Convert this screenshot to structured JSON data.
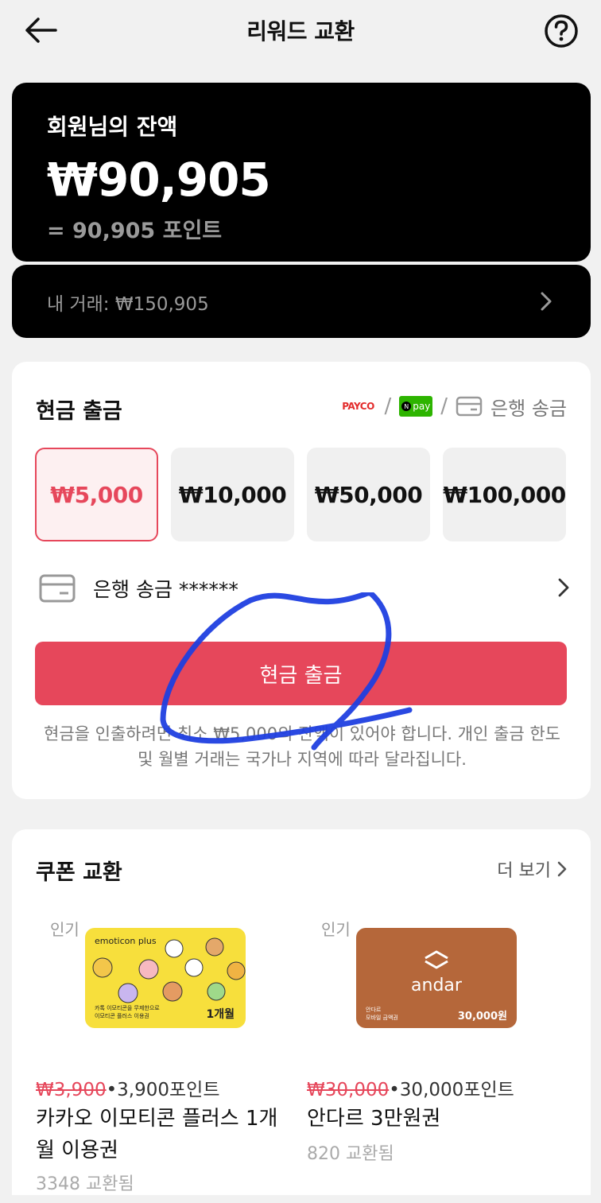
{
  "header": {
    "title": "리워드 교환"
  },
  "balance": {
    "label": "회원님의 잔액",
    "amount": "₩90,905",
    "points": "= 90,905 포인트",
    "transactions": "내 거래: ₩150,905"
  },
  "cash_withdrawal": {
    "title": "현금 출금",
    "methods": {
      "payco": "PAYCO",
      "npay": "pay",
      "bank": "은행 송금",
      "separator": "/"
    },
    "amounts": [
      {
        "label": "₩5,000",
        "selected": true
      },
      {
        "label": "₩10,000",
        "selected": false
      },
      {
        "label": "₩50,000",
        "selected": false
      },
      {
        "label": "₩100,000",
        "selected": false
      }
    ],
    "bank_account": "은행 송금 ******",
    "button": "현금 출금",
    "notice": "현금을 인출하려면 최소 ₩5,000의 잔액이 있어야 합니다. 개인 출금 한도 및 월별 거래는 국가나 지역에 따라 달라집니다."
  },
  "coupons": {
    "title": "쿠폰 교환",
    "more": "더 보기",
    "items": [
      {
        "badge": "인기",
        "original_price": "₩3,900",
        "points": "•3,900포인트",
        "name": "카카오 이모티콘 플러스 1개월 이용권",
        "exchanged": "3348 교환됨",
        "image": {
          "brand": "emoticon plus",
          "caption_line1": "카톡 이모티콘을 무제한으로",
          "caption_line2": "이모티콘 플러스 이용권",
          "period": "1개월",
          "color": "#f7df3c"
        }
      },
      {
        "badge": "인기",
        "original_price": "₩30,000",
        "points": "•30,000포인트",
        "name": "안다르 3만원권",
        "exchanged": "820 교환됨",
        "image": {
          "brand": "andar",
          "caption_line1": "안다르",
          "caption_line2": "모바일 금액권",
          "value": "30,000원",
          "color": "#b5673a"
        }
      }
    ]
  },
  "colors": {
    "accent": "#e6475b",
    "card_dark": "#000000",
    "background": "#f1f1f1"
  }
}
